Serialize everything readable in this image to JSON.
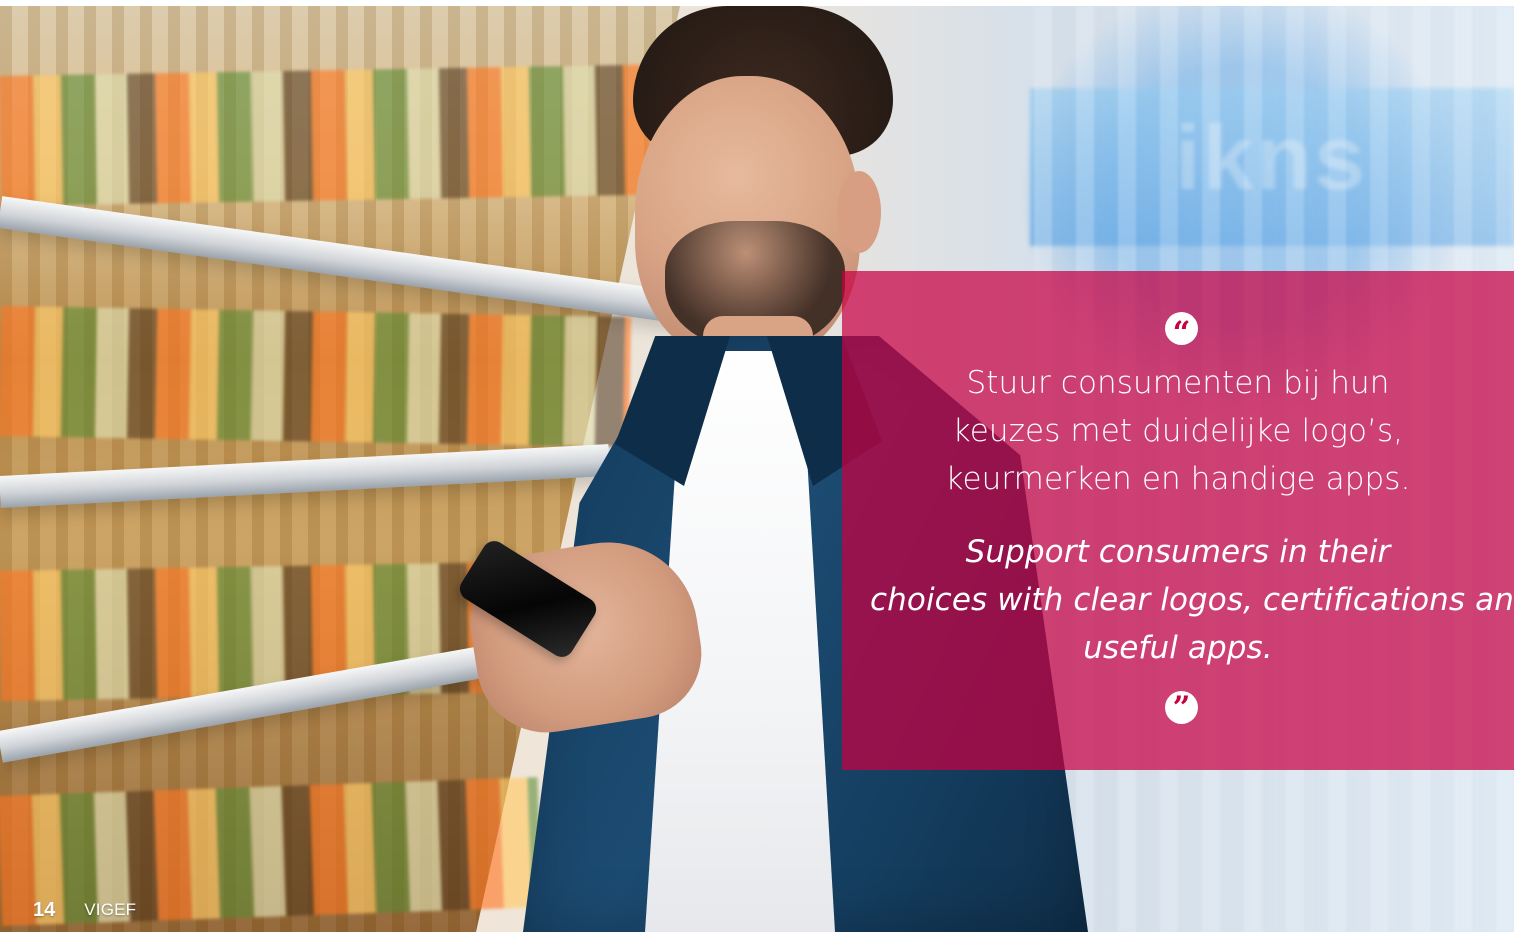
{
  "quote": {
    "open_mark": "“",
    "dutch_lines": [
      "Stuur consumenten bij hun",
      "keuzes met duidelijke logo’s,",
      "keurmerken en handige apps."
    ],
    "english_lines": [
      "Support consumers in their",
      "choices with clear logos, certifications and",
      "useful apps."
    ],
    "close_mark": "”"
  },
  "footer": {
    "page_number": "14",
    "brand": "VIGEF"
  },
  "colors": {
    "quote_background": "#c70042",
    "quote_text": "#ffffff",
    "quote_mark_text": "#c70042"
  },
  "visuals": {
    "photo": "man-holding-phone-in-supermarket-aisle",
    "quote_mark_icon": "quotation-mark-icon"
  }
}
